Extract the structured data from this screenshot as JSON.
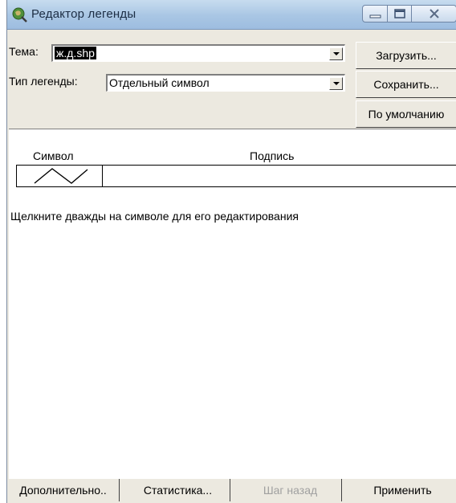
{
  "window": {
    "title": "Редактор легенды",
    "icon": "legend-editor-icon",
    "controls": [
      "minimize-icon",
      "maximize-icon",
      "close-icon"
    ]
  },
  "theme": {
    "label": "Тема:",
    "value": "ж.д.shp"
  },
  "legend_type": {
    "label": "Тип легенды:",
    "value": "Отдельный символ"
  },
  "buttons": {
    "load": "Загрузить...",
    "save": "Сохранить...",
    "default": "По умолчанию"
  },
  "table": {
    "columns": [
      "Символ",
      "Подпись"
    ],
    "rows": [
      {
        "symbol": "line-symbol",
        "label": ""
      }
    ]
  },
  "hint": "Щелкните дважды на символе для его редактирования",
  "bottom": {
    "advanced": "Дополнительно..",
    "statistics": "Статистика...",
    "undo": "Шаг назад",
    "apply": "Применить"
  }
}
